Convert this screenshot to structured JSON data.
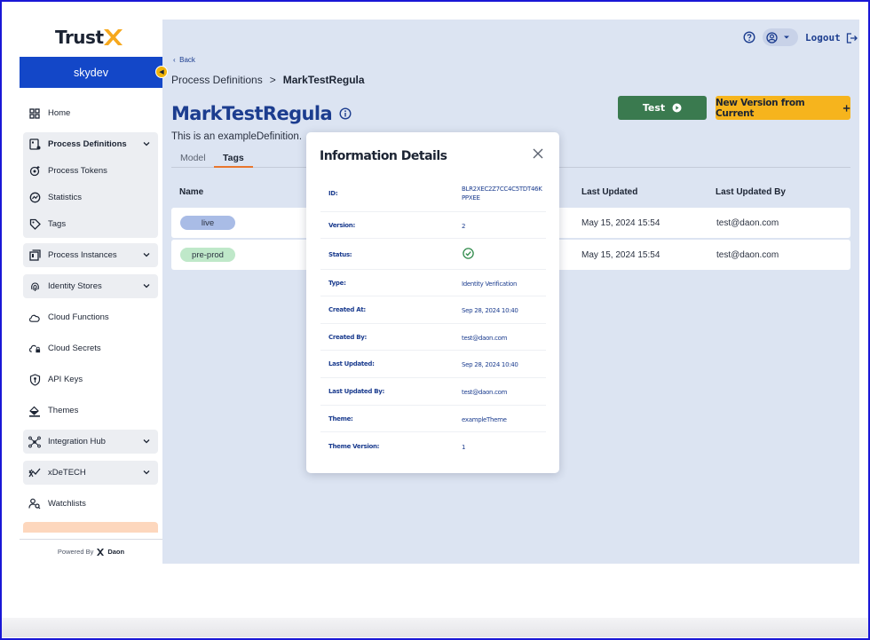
{
  "sidebar": {
    "brand": "Trust",
    "environment": "skydev",
    "items": [
      {
        "label": "Home",
        "icon": "home-grid-icon"
      },
      {
        "label": "Process Definitions",
        "icon": "process-definitions-icon"
      },
      {
        "label": "Process Tokens",
        "icon": "process-tokens-icon"
      },
      {
        "label": "Statistics",
        "icon": "statistics-icon"
      },
      {
        "label": "Tags",
        "icon": "tag-icon"
      },
      {
        "label": "Process Instances",
        "icon": "process-instances-icon"
      },
      {
        "label": "Identity Stores",
        "icon": "fingerprint-icon"
      },
      {
        "label": "Cloud Functions",
        "icon": "cloud-icon"
      },
      {
        "label": "Cloud Secrets",
        "icon": "cloud-lock-icon"
      },
      {
        "label": "API Keys",
        "icon": "key-shield-icon"
      },
      {
        "label": "Themes",
        "icon": "paint-bucket-icon"
      },
      {
        "label": "Integration Hub",
        "icon": "hub-icon"
      },
      {
        "label": "xDeTECH",
        "icon": "xdetech-icon"
      },
      {
        "label": "Watchlists",
        "icon": "watchlist-icon"
      }
    ],
    "powered_by": "Powered By",
    "powered_brand": "Daon"
  },
  "header": {
    "logout_label": "Logout"
  },
  "main": {
    "back_label": "Back",
    "breadcrumb_parent": "Process Definitions",
    "breadcrumb_sep": ">",
    "breadcrumb_current": "MarkTestRegula",
    "title": "MarkTestRegula",
    "description": "This is an exampleDefinition.",
    "tabs": [
      "Model",
      "Tags"
    ],
    "active_tab": "Tags",
    "test_button": "Test",
    "new_version_button": "New Version from Current",
    "table": {
      "headers": [
        "Name",
        "Last Updated",
        "Last Updated By"
      ],
      "rows": [
        {
          "name": "live",
          "last_updated": "May 15, 2024 15:54",
          "last_updated_by": "test@daon.com"
        },
        {
          "name": "pre-prod",
          "last_updated": "May 15, 2024 15:54",
          "last_updated_by": "test@daon.com"
        }
      ]
    }
  },
  "modal": {
    "title": "Information Details",
    "details": [
      {
        "label": "ID:",
        "value": "BLR2XEC2Z7CC4C5TDT46KPPXEE"
      },
      {
        "label": "Version:",
        "value": "2"
      },
      {
        "label": "Status:",
        "value": ""
      },
      {
        "label": "Type:",
        "value": "Identity Verification"
      },
      {
        "label": "Created At:",
        "value": "Sep 28, 2024 10:40"
      },
      {
        "label": "Created By:",
        "value": "test@daon.com"
      },
      {
        "label": "Last Updated:",
        "value": "Sep 28, 2024 10:40"
      },
      {
        "label": "Last Updated By:",
        "value": "test@daon.com"
      },
      {
        "label": "Theme:",
        "value": "exampleTheme"
      },
      {
        "label": "Theme Version:",
        "value": "1"
      }
    ]
  },
  "colors": {
    "brand_blue": "#1347c8",
    "accent_orange": "#e8762e",
    "test_green": "#3a7a4f",
    "new_version_yellow": "#f6b41d",
    "live_tag": "#a9bce6",
    "preprod_tag": "#bfe8c9",
    "main_bg": "#dce4f2"
  }
}
